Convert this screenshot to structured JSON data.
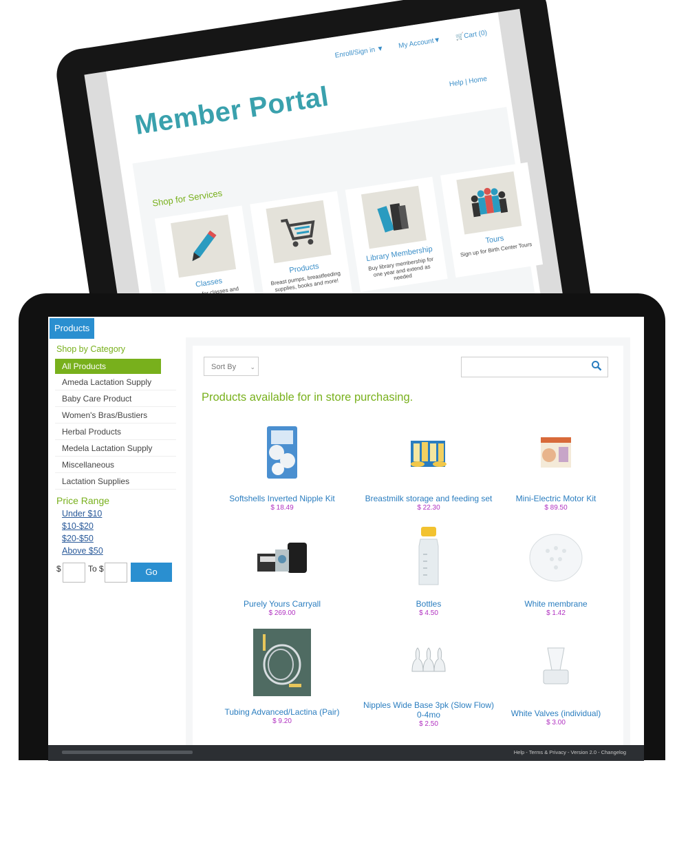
{
  "tablet": {
    "nav": {
      "enroll": "Enroll/Sign in ▼",
      "account": "My Account▼",
      "cart": "Cart (0)"
    },
    "title": "Member Portal",
    "help_home": "Help | Home",
    "shop_services": "Shop for Services",
    "cards": [
      {
        "icon": "pencil-icon",
        "label": "Classes",
        "desc": "Sign up for classes and packages"
      },
      {
        "icon": "cart-icon",
        "label": "Products",
        "desc": "Breast pumps, breastfeeding supplies, books and more!"
      },
      {
        "icon": "books-icon",
        "label": "Library Membership",
        "desc": "Buy library membership for one year and extend as needed"
      },
      {
        "icon": "people-icon",
        "label": "Tours",
        "desc": "Sign up for Birth Center Tours"
      }
    ]
  },
  "laptop": {
    "tab_label": "Products",
    "sidebar": {
      "category_heading": "Shop by Category",
      "categories": [
        "All Products",
        "Ameda Lactation Supply",
        "Baby Care Product",
        "Women's Bras/Bustiers",
        "Herbal Products",
        "Medela Lactation Supply",
        "Miscellaneous",
        "Lactation Supplies"
      ],
      "price_heading": "Price Range",
      "price_links": [
        "Under $10",
        "$10-$20",
        "$20-$50",
        "Above $50"
      ],
      "range_from": "$",
      "range_to": "To $",
      "go_label": "Go"
    },
    "main": {
      "sort_label": "Sort By",
      "heading": "Products available for in store purchasing.",
      "products": [
        {
          "name": "Softshells Inverted Nipple Kit",
          "price": "$ 18.49"
        },
        {
          "name": "Breastmilk storage and feeding set",
          "price": "$ 22.30"
        },
        {
          "name": "Mini-Electric Motor Kit",
          "price": "$ 89.50"
        },
        {
          "name": "Purely Yours Carryall",
          "price": "$ 269.00"
        },
        {
          "name": "Bottles",
          "price": "$ 4.50"
        },
        {
          "name": "White membrane",
          "price": "$ 1.42"
        },
        {
          "name": "Tubing Advanced/Lactina (Pair)",
          "price": "$ 9.20"
        },
        {
          "name": "Nipples Wide Base 3pk (Slow Flow) 0-4mo",
          "price": "$ 2.50"
        },
        {
          "name": "White Valves (individual)",
          "price": "$ 3.00"
        }
      ]
    },
    "footer": {
      "links": "Help - Terms & Privacy - Version 2.0 - Changelog"
    }
  }
}
